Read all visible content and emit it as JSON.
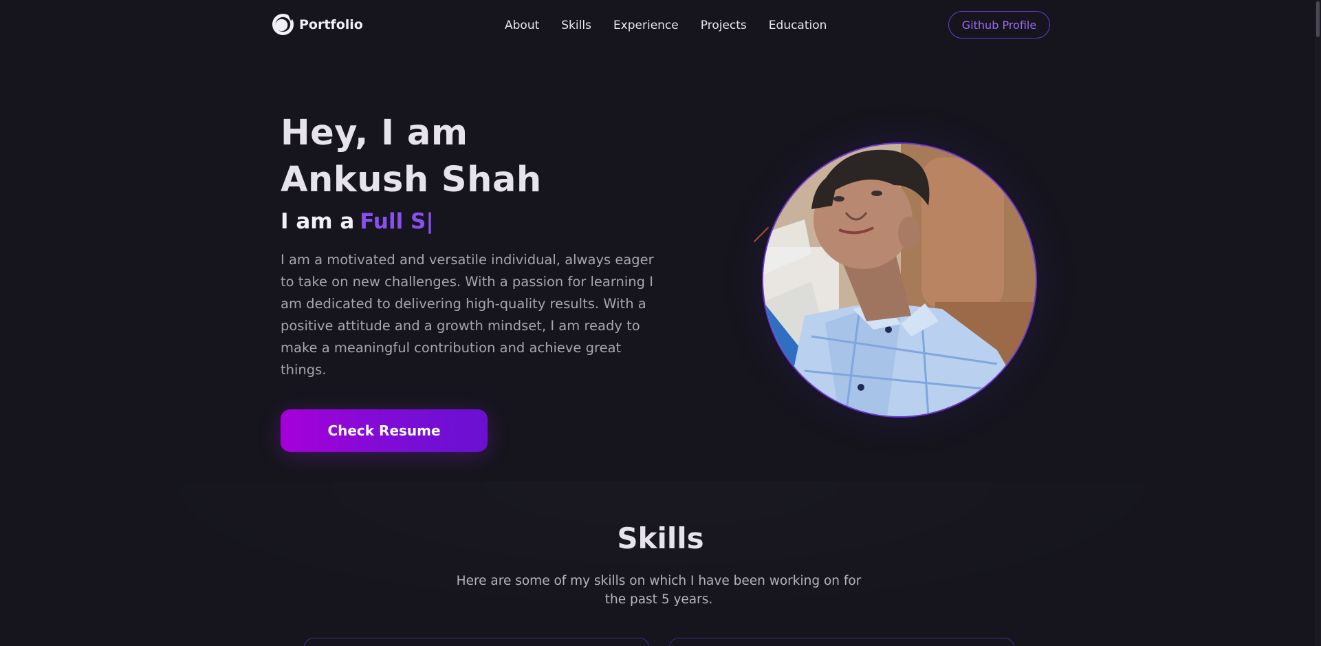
{
  "nav": {
    "brand": "Portfolio",
    "logo_icon": "portfolio-logo-icon",
    "links": [
      "About",
      "Skills",
      "Experience",
      "Projects",
      "Education"
    ],
    "github_button": "Github Profile"
  },
  "hero": {
    "title_line1": "Hey, I am",
    "title_line2": "Ankush Shah",
    "role_prefix": "I am a",
    "role_typed": "Full S|",
    "description": "I am a motivated and versatile individual, always eager to take on new challenges. With a passion for learning I am dedicated to delivering high-quality results. With a positive attitude and a growth mindset, I am ready to make a meaningful contribution and achieve great things.",
    "resume_button": "Check Resume"
  },
  "skills": {
    "title": "Skills",
    "description": "Here are some of my skills on which I have been working on for the past 5 years."
  },
  "colors": {
    "background": "#16151d",
    "accent": "#8a4ff0",
    "button_gradient_start": "#a600d8",
    "button_gradient_end": "#6a10d2"
  }
}
